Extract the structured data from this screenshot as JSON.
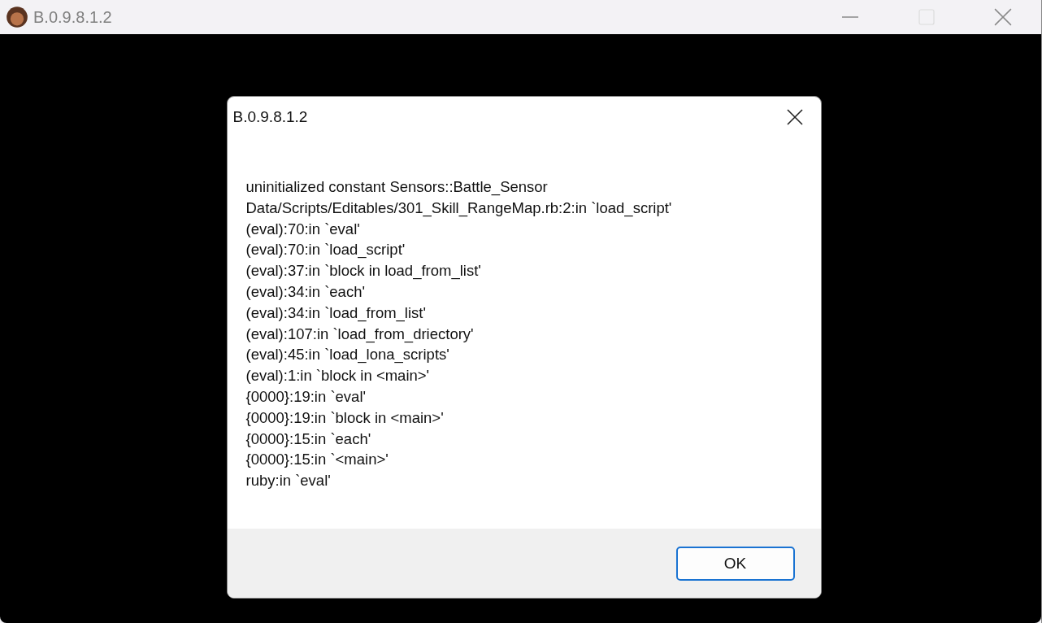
{
  "window": {
    "title": "B.0.9.8.1.2",
    "maximize_disabled": true
  },
  "dialog": {
    "title": "B.0.9.8.1.2",
    "lines": [
      "uninitialized constant Sensors::Battle_Sensor",
      "Data/Scripts/Editables/301_Skill_RangeMap.rb:2:in `load_script'",
      "(eval):70:in `eval'",
      "(eval):70:in `load_script'",
      "(eval):37:in `block in load_from_list'",
      "(eval):34:in `each'",
      "(eval):34:in `load_from_list'",
      "(eval):107:in `load_from_driectory'",
      "(eval):45:in `load_lona_scripts'",
      "(eval):1:in `block in <main>'",
      "{0000}:19:in `eval'",
      "{0000}:19:in `block in <main>'",
      "{0000}:15:in `each'",
      "{0000}:15:in `<main>'",
      "ruby:in `eval'"
    ],
    "buttons": [
      "OK"
    ]
  }
}
